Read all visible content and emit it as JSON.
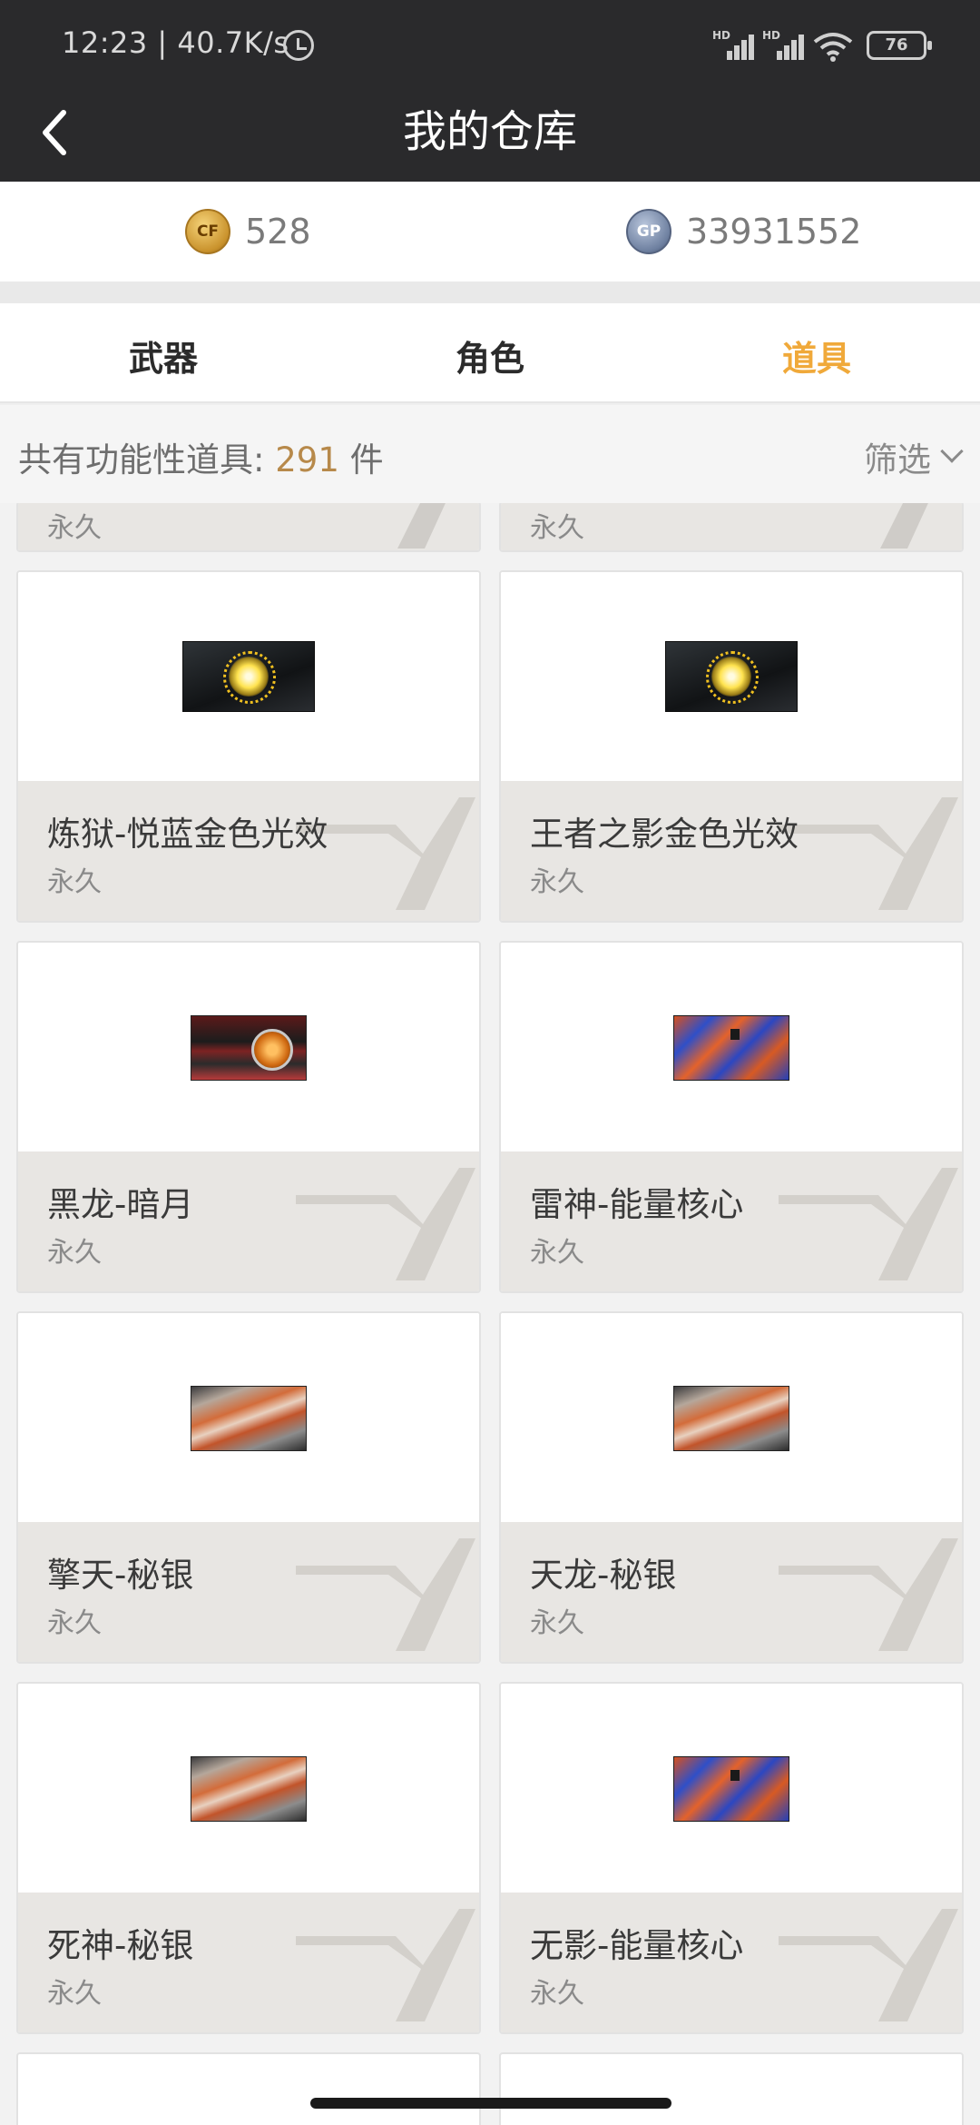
{
  "status_bar": {
    "time": "12:23 | 40.7K/s",
    "battery": "76",
    "signal_label": "HD"
  },
  "header": {
    "title": "我的仓库"
  },
  "currency": {
    "cf_points": "528",
    "gp_points": "33931552"
  },
  "tabs": [
    {
      "label": "武器",
      "active": false
    },
    {
      "label": "角色",
      "active": false
    },
    {
      "label": "道具",
      "active": true
    }
  ],
  "summary": {
    "prefix": "共有功能性道具:",
    "count": "291",
    "suffix": "件",
    "filter_label": "筛选"
  },
  "items": [
    {
      "name": "",
      "duration": "永久",
      "thumb": "partial"
    },
    {
      "name": "",
      "duration": "永久",
      "thumb": "partial"
    },
    {
      "name": "炼狱-悦蓝金色光效",
      "duration": "永久",
      "thumb": "golden-glow"
    },
    {
      "name": "王者之影金色光效",
      "duration": "永久",
      "thumb": "golden-glow"
    },
    {
      "name": "黑龙-暗月",
      "duration": "永久",
      "thumb": "dark-moon"
    },
    {
      "name": "雷神-能量核心",
      "duration": "永久",
      "thumb": "energy-core"
    },
    {
      "name": "擎天-秘银",
      "duration": "永久",
      "thumb": "mithril"
    },
    {
      "name": "天龙-秘银",
      "duration": "永久",
      "thumb": "mithril"
    },
    {
      "name": "死神-秘银",
      "duration": "永久",
      "thumb": "mithril"
    },
    {
      "name": "无影-能量核心",
      "duration": "永久",
      "thumb": "energy-core"
    }
  ],
  "colors": {
    "header_bg": "#2a2a2c",
    "active_tab": "#f0a93a",
    "count_accent": "#b7894a",
    "card_info_bg": "#e8e6e3"
  }
}
